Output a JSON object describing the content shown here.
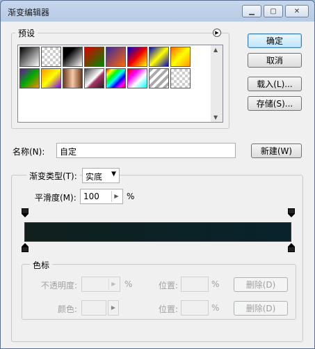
{
  "window": {
    "title": "渐变编辑器"
  },
  "presets": {
    "label": "预设",
    "swatches": [
      {
        "name": "black-white",
        "css": "linear-gradient(135deg,#000,#fff)"
      },
      {
        "name": "transparent",
        "css": "checker"
      },
      {
        "name": "black-white-2",
        "css": "linear-gradient(135deg,#000 30%,#fff)"
      },
      {
        "name": "red-green",
        "css": "linear-gradient(135deg,#d00,#080)"
      },
      {
        "name": "violet-orange",
        "css": "linear-gradient(135deg,#3a2aa0,#f60)"
      },
      {
        "name": "blue-red-yellow",
        "css": "linear-gradient(135deg,#00c,#e00,#ff0)"
      },
      {
        "name": "blue-yellow-blue",
        "css": "linear-gradient(135deg,#00c,#ff0,#00c)"
      },
      {
        "name": "orange-yellow",
        "css": "linear-gradient(135deg,#f60,#ff0,#f90)"
      },
      {
        "name": "violet-green-orange",
        "css": "linear-gradient(135deg,#6a0dad,#0a0,#f80)"
      },
      {
        "name": "yellow-violet",
        "css": "linear-gradient(135deg,#f90,#ff0,#70f)"
      },
      {
        "name": "copper",
        "css": "linear-gradient(90deg,#6b3a1a,#f6c8a8,#6b3a1a)"
      },
      {
        "name": "chrome",
        "css": "linear-gradient(135deg,#444,#fff 50%,#a36 60%,#222)"
      },
      {
        "name": "spectrum",
        "css": "linear-gradient(135deg,#f00,#ff0,#0f0,#0ff,#00f,#f0f,#f00)"
      },
      {
        "name": "spectrum-stripe",
        "css": "linear-gradient(135deg,#f00,#f0f,#fff 60%,#0ff)"
      },
      {
        "name": "silver-stripe",
        "css": "repeating-linear-gradient(135deg,#aaa 0 4px,#fff 4px 8px)"
      },
      {
        "name": "transparent-2",
        "css": "checker"
      }
    ]
  },
  "buttons": {
    "ok": "确定",
    "cancel": "取消",
    "load": "载入(L)...",
    "save": "存储(S)...",
    "new": "新建(W)",
    "delete_opacity": "删除(D)",
    "delete_color": "删除(D)"
  },
  "name": {
    "label": "名称(N):",
    "value": "自定"
  },
  "gradient": {
    "type_label": "渐变类型(T):",
    "type_value": "实底",
    "smooth_label": "平滑度(M):",
    "smooth_value": "100",
    "smooth_unit": "%",
    "colors": {
      "start": "#10201d",
      "end": "#08232c"
    }
  },
  "stops": {
    "label": "色标",
    "opacity_label": "不透明度:",
    "opacity_unit": "%",
    "location_label": "位置:",
    "location_unit": "%",
    "color_label": "颜色:",
    "location2_label": "位置:",
    "location2_unit": "%"
  }
}
